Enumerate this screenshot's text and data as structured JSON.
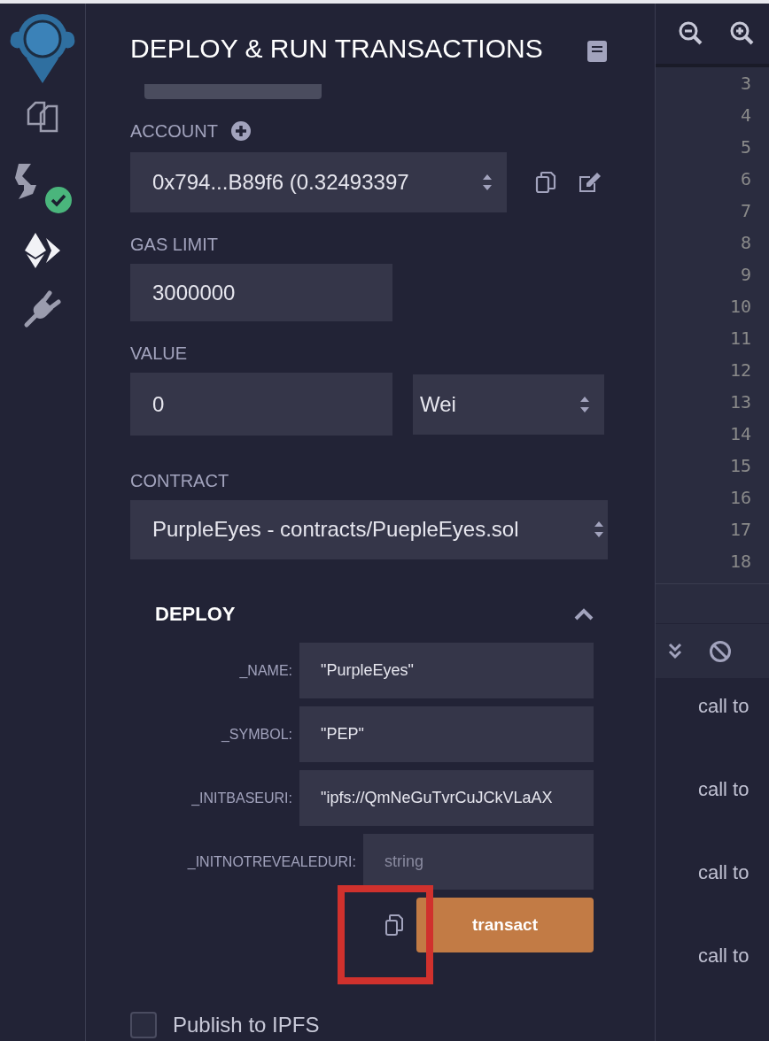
{
  "sidebar": {
    "items": [
      {
        "kind": "logo"
      },
      {
        "kind": "files",
        "selected": false
      },
      {
        "kind": "compiler",
        "selected": false,
        "compiled": true
      },
      {
        "kind": "deploy",
        "selected": true
      },
      {
        "kind": "plugins",
        "selected": false
      }
    ]
  },
  "panel": {
    "title": "DEPLOY & RUN TRANSACTIONS",
    "account": {
      "label": "ACCOUNT",
      "value": "0x794...B89f6 (0.32493397"
    },
    "gas_limit": {
      "label": "GAS LIMIT",
      "value": "3000000"
    },
    "value": {
      "label": "VALUE",
      "value": "0",
      "unit": "Wei"
    },
    "contract": {
      "label": "CONTRACT",
      "value": "PurpleEyes - contracts/PuepleEyes.sol"
    },
    "deploy": {
      "title": "DEPLOY",
      "expanded": true,
      "params": [
        {
          "label": "_NAME:",
          "value": "\"PurpleEyes\""
        },
        {
          "label": "_SYMBOL:",
          "value": "\"PEP\""
        },
        {
          "label": "_INITBASEURI:",
          "value": "\"ipfs://QmNeGuTvrCuJCkVLaAX"
        },
        {
          "label": "_INITNOTREVEALEDURI:",
          "placeholder": "string"
        }
      ],
      "button": "transact"
    },
    "publish": {
      "label": "Publish to IPFS",
      "checked": false
    }
  },
  "editor": {
    "line_numbers": [
      "3",
      "4",
      "5",
      "6",
      "7",
      "8",
      "9",
      "10",
      "11",
      "12",
      "13",
      "14",
      "15",
      "16",
      "17",
      "18"
    ]
  },
  "terminal": {
    "lines": [
      "call to",
      "call to",
      "call to",
      "call to"
    ]
  }
}
